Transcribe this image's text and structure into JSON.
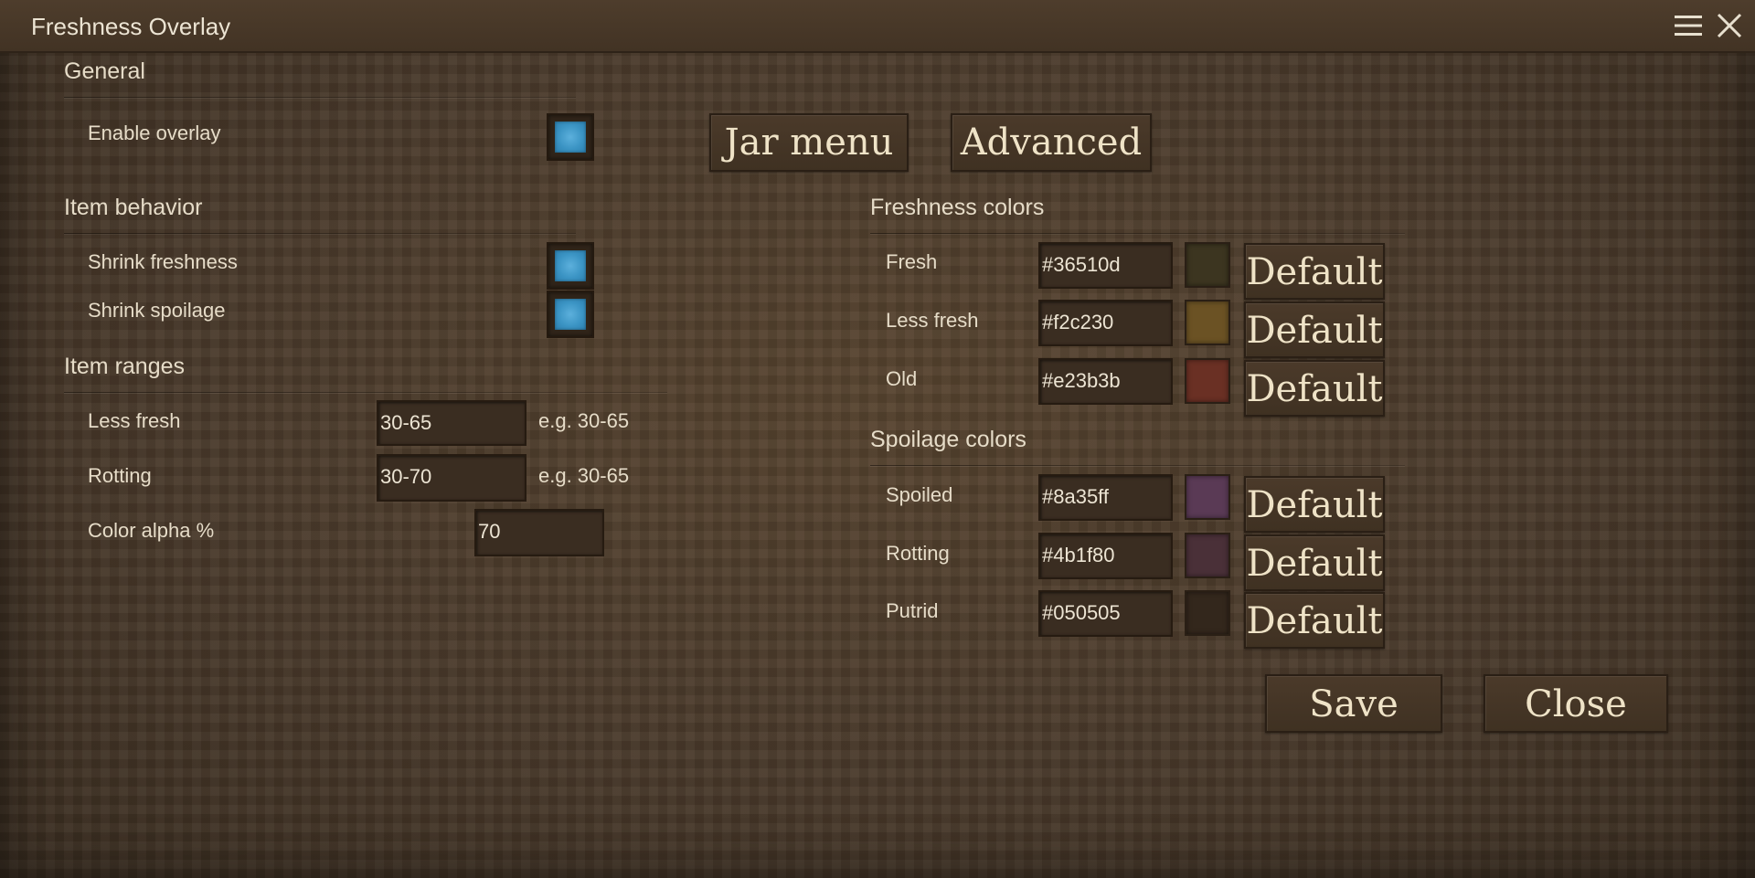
{
  "window": {
    "title": "Freshness Overlay",
    "menu_icon": "hamburger-menu-icon",
    "close_icon": "close-x-icon"
  },
  "general": {
    "header": "General",
    "enable_overlay": {
      "label": "Enable overlay",
      "checked": true
    }
  },
  "item_behavior": {
    "header": "Item behavior",
    "shrink_freshness": {
      "label": "Shrink freshness",
      "checked": true
    },
    "shrink_spoilage": {
      "label": "Shrink spoilage",
      "checked": true
    }
  },
  "item_ranges": {
    "header": "Item ranges",
    "less_fresh": {
      "label": "Less fresh",
      "value": "30-65",
      "hint": "e.g. 30-65"
    },
    "rotting": {
      "label": "Rotting",
      "value": "30-70",
      "hint": "e.g. 30-65"
    },
    "color_alpha": {
      "label": "Color alpha %",
      "value": "70"
    }
  },
  "top_buttons": {
    "jar_menu": "Jar menu",
    "advanced": "Advanced"
  },
  "freshness_colors": {
    "header": "Freshness colors",
    "rows": [
      {
        "label": "Fresh",
        "value": "#36510d",
        "swatch": "#3c3520",
        "button": "Default"
      },
      {
        "label": "Less fresh",
        "value": "#f2c230",
        "swatch": "#6b5224",
        "button": "Default"
      },
      {
        "label": "Old",
        "value": "#e23b3b",
        "swatch": "#6a3024",
        "button": "Default"
      }
    ]
  },
  "spoilage_colors": {
    "header": "Spoilage colors",
    "rows": [
      {
        "label": "Spoiled",
        "value": "#8a35ff",
        "swatch": "#5a3a55",
        "button": "Default"
      },
      {
        "label": "Rotting",
        "value": "#4b1f80",
        "swatch": "#4a3038",
        "button": "Default"
      },
      {
        "label": "Putrid",
        "value": "#050505",
        "swatch": "#33271c",
        "button": "Default"
      }
    ]
  },
  "footer": {
    "save": "Save",
    "close": "Close"
  }
}
